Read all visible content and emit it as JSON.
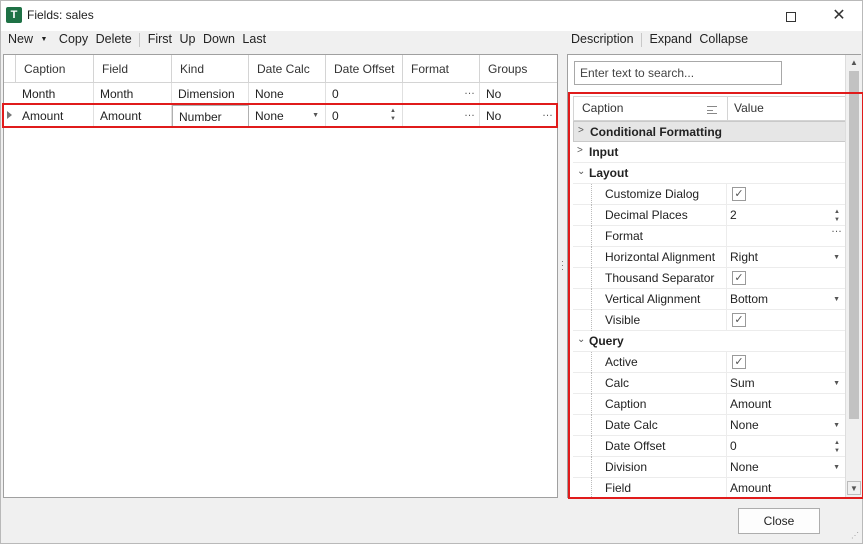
{
  "window": {
    "title": "Fields: sales",
    "app_icon_letter": "T"
  },
  "left_toolbar": [
    "New",
    "Copy",
    "Delete",
    "First",
    "Up",
    "Down",
    "Last"
  ],
  "right_toolbar": [
    "Description",
    "Expand",
    "Collapse"
  ],
  "grid": {
    "columns": [
      "Caption",
      "Field",
      "Kind",
      "Date Calc",
      "Date Offset",
      "Format",
      "Groups"
    ],
    "rows": [
      [
        "Month",
        "Month",
        "Dimension",
        "None",
        "0",
        "",
        "No"
      ],
      [
        "Amount",
        "Amount",
        "Number",
        "None",
        "0",
        "",
        "No"
      ]
    ],
    "selected_row": 1
  },
  "property_grid": {
    "search_placeholder": "Enter text to search...",
    "header_caption": "Caption",
    "header_value": "Value",
    "rows": [
      {
        "type": "category",
        "label": "Conditional Formatting",
        "expanded": false,
        "highlighted": true
      },
      {
        "type": "category",
        "label": "Input",
        "expanded": false
      },
      {
        "type": "category",
        "label": "Layout",
        "expanded": true
      },
      {
        "type": "property",
        "label": "Customize Dialog",
        "editor": "checkbox",
        "checked": true
      },
      {
        "type": "property",
        "label": "Decimal Places",
        "value": "2",
        "editor": "spin"
      },
      {
        "type": "property",
        "label": "Format",
        "value": "",
        "editor": "ellipsis"
      },
      {
        "type": "property",
        "label": "Horizontal Alignment",
        "value": "Right",
        "editor": "dropdown"
      },
      {
        "type": "property",
        "label": "Thousand Separator",
        "editor": "checkbox",
        "checked": true
      },
      {
        "type": "property",
        "label": "Vertical Alignment",
        "value": "Bottom",
        "editor": "dropdown"
      },
      {
        "type": "property",
        "label": "Visible",
        "editor": "checkbox",
        "checked": true
      },
      {
        "type": "category",
        "label": "Query",
        "expanded": true
      },
      {
        "type": "property",
        "label": "Active",
        "editor": "checkbox",
        "checked": true
      },
      {
        "type": "property",
        "label": "Calc",
        "value": "Sum",
        "editor": "dropdown"
      },
      {
        "type": "property",
        "label": "Caption",
        "value": "Amount",
        "editor": "text"
      },
      {
        "type": "property",
        "label": "Date Calc",
        "value": "None",
        "editor": "dropdown"
      },
      {
        "type": "property",
        "label": "Date Offset",
        "value": "0",
        "editor": "spin"
      },
      {
        "type": "property",
        "label": "Division",
        "value": "None",
        "editor": "dropdown"
      },
      {
        "type": "property",
        "label": "Field",
        "value": "Amount",
        "editor": "text"
      }
    ]
  },
  "footer": {
    "close_label": "Close"
  },
  "colors": {
    "highlight_border": "#e01b1b",
    "app_icon": "#1e7145"
  }
}
